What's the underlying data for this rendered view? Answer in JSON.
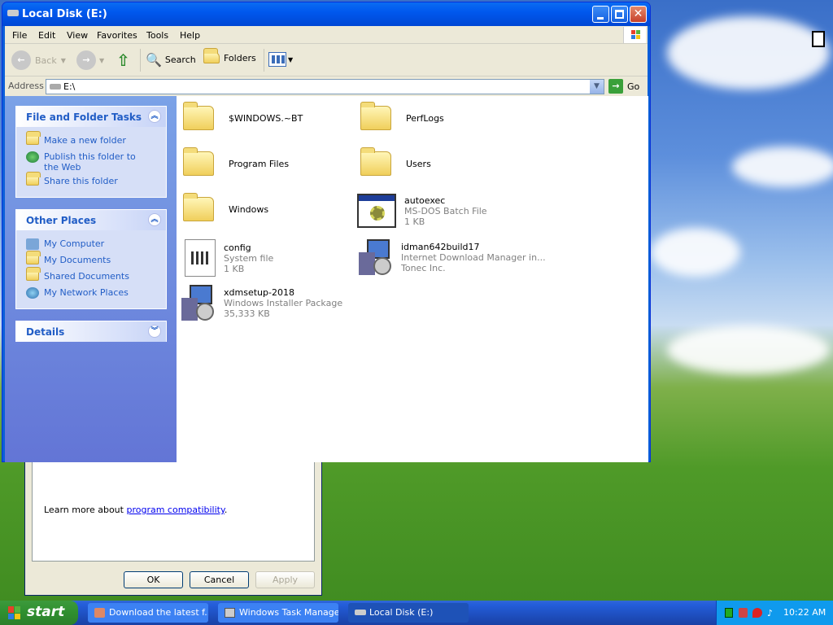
{
  "window": {
    "title": "Local Disk (E:)"
  },
  "menu": [
    "File",
    "Edit",
    "View",
    "Favorites",
    "Tools",
    "Help"
  ],
  "toolbar": {
    "back": "Back",
    "search": "Search",
    "folders": "Folders"
  },
  "address": {
    "label": "Address",
    "value": "E:\\",
    "go": "Go"
  },
  "tasks_panel": {
    "title": "File and Folder Tasks",
    "items": [
      "Make a new folder",
      "Publish this folder to the Web",
      "Share this folder"
    ]
  },
  "places_panel": {
    "title": "Other Places",
    "items": [
      "My Computer",
      "My Documents",
      "Shared Documents",
      "My Network Places"
    ]
  },
  "details_panel": {
    "title": "Details"
  },
  "files": [
    {
      "name": "$WINDOWS.~BT",
      "type": "folder"
    },
    {
      "name": "PerfLogs",
      "type": "folder"
    },
    {
      "name": "Program Files",
      "type": "folder"
    },
    {
      "name": "Users",
      "type": "folder"
    },
    {
      "name": "Windows",
      "type": "folder"
    },
    {
      "name": "autoexec",
      "line2": "MS-DOS Batch File",
      "line3": "1 KB",
      "type": "batch"
    },
    {
      "name": "config",
      "line2": "System file",
      "line3": "1 KB",
      "type": "system"
    },
    {
      "name": "idman642build17",
      "line2": "Internet Download Manager in...",
      "line3": "Tonec Inc.",
      "type": "installer"
    },
    {
      "name": "xdmsetup-2018",
      "line2": "Windows Installer Package",
      "line3": "35,333 KB",
      "type": "msi"
    }
  ],
  "dialog": {
    "learn_text": "Learn more about ",
    "learn_link": "program compatibility",
    "learn_end": ".",
    "ok": "OK",
    "cancel": "Cancel",
    "apply": "Apply"
  },
  "taskbar": {
    "start": "start",
    "tasks": [
      "Download the latest f...",
      "Windows Task Manager",
      "Local Disk (E:)"
    ],
    "clock": "10:22 AM"
  }
}
